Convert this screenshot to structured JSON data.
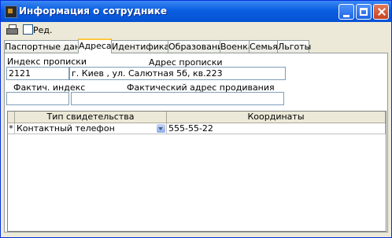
{
  "window": {
    "title": "Информация о сотруднике"
  },
  "toolbar": {
    "edit_label": "Ред."
  },
  "tabs": [
    {
      "label": "Паспортные данные"
    },
    {
      "label": "Адреса"
    },
    {
      "label": "Идентификация"
    },
    {
      "label": "Образование"
    },
    {
      "label": "Военка"
    },
    {
      "label": "Семья"
    },
    {
      "label": "Льготы"
    }
  ],
  "address": {
    "reg_index_label": "Индекс прописки",
    "reg_address_label": "Адрес прописки",
    "reg_index_value": "2121",
    "reg_address_value": "г. Киев , ул. Салютная 5б, кв.223",
    "fact_index_label": "Фактич. индекс",
    "fact_address_label": "Фактический адрес продивания",
    "fact_index_value": "",
    "fact_address_value": ""
  },
  "contacts": {
    "columns": [
      "Тип свидетельства",
      "Координаты"
    ],
    "rows": [
      {
        "marker": "*",
        "type": "Контактный телефон",
        "value": "555-55-22"
      }
    ]
  }
}
